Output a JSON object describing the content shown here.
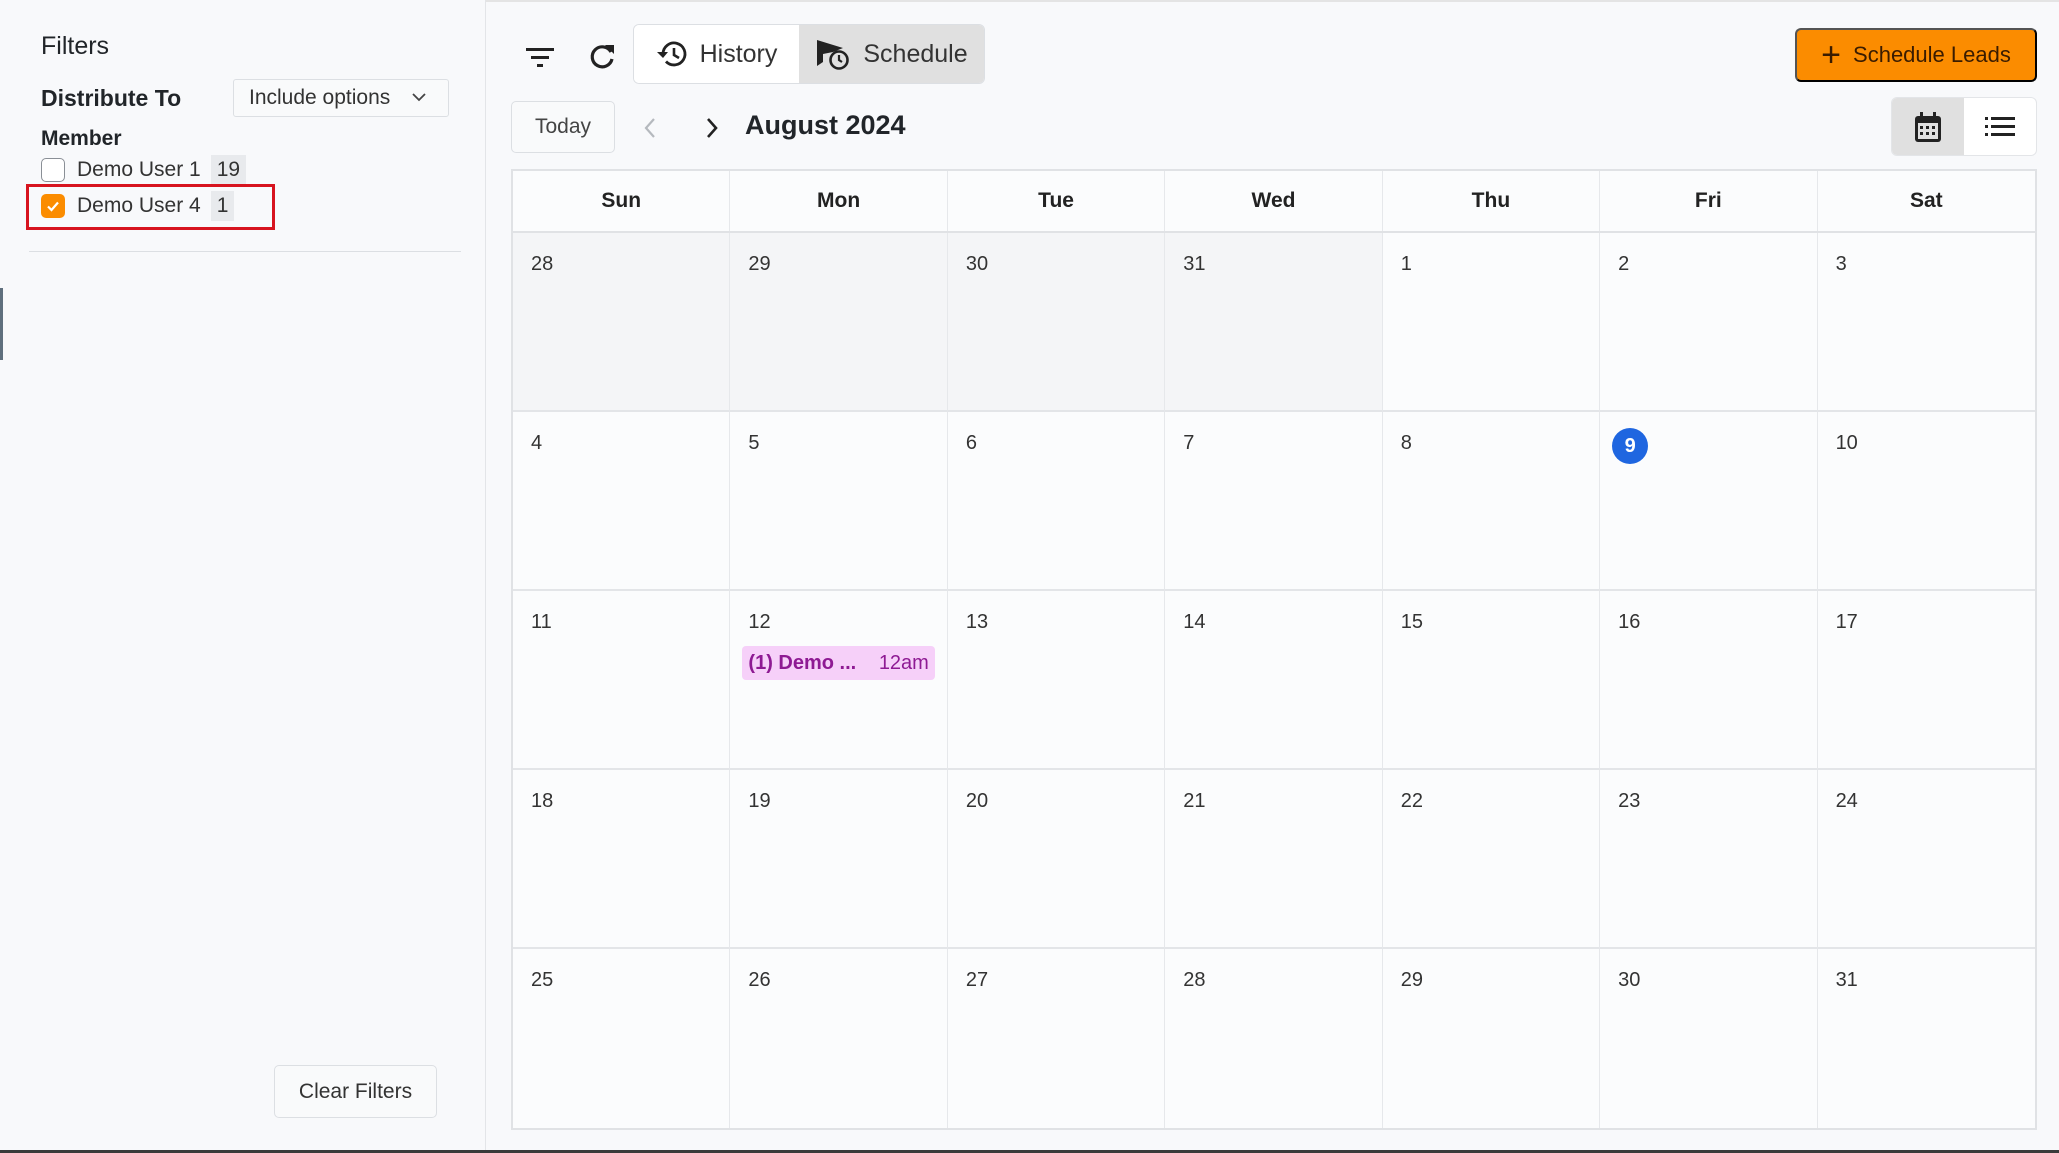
{
  "sidebar": {
    "title": "Filters",
    "distribute_to": {
      "label": "Distribute To",
      "selected": "Include options"
    },
    "member_label": "Member",
    "members": [
      {
        "name": "Demo User 1",
        "count": "19",
        "checked": false
      },
      {
        "name": "Demo User 4",
        "count": "1",
        "checked": true
      }
    ],
    "clear_button": "Clear Filters"
  },
  "toolbar": {
    "filter_icon": "filter-icon",
    "refresh_icon": "refresh-icon",
    "tabs": [
      {
        "label": "History",
        "icon": "history-icon",
        "active": false
      },
      {
        "label": "Schedule",
        "icon": "schedule-icon",
        "active": true
      }
    ],
    "schedule_leads_label": "Schedule Leads",
    "accent_color": "#fb8c00"
  },
  "calendar_nav": {
    "today_label": "Today",
    "month_title": "August 2024",
    "views": [
      {
        "name": "calendar-view",
        "active": true
      },
      {
        "name": "list-view",
        "active": false
      }
    ]
  },
  "calendar": {
    "weekdays": [
      "Sun",
      "Mon",
      "Tue",
      "Wed",
      "Thu",
      "Fri",
      "Sat"
    ],
    "today": "9",
    "today_color": "#1f66e0",
    "weeks": [
      [
        {
          "day": "28",
          "other": true
        },
        {
          "day": "29",
          "other": true
        },
        {
          "day": "30",
          "other": true
        },
        {
          "day": "31",
          "other": true
        },
        {
          "day": "1"
        },
        {
          "day": "2"
        },
        {
          "day": "3"
        }
      ],
      [
        {
          "day": "4"
        },
        {
          "day": "5"
        },
        {
          "day": "6"
        },
        {
          "day": "7"
        },
        {
          "day": "8"
        },
        {
          "day": "9",
          "today": true
        },
        {
          "day": "10"
        }
      ],
      [
        {
          "day": "11"
        },
        {
          "day": "12",
          "events": [
            {
              "title": "(1) Demo ...",
              "time": "12am"
            }
          ]
        },
        {
          "day": "13"
        },
        {
          "day": "14"
        },
        {
          "day": "15"
        },
        {
          "day": "16"
        },
        {
          "day": "17"
        }
      ],
      [
        {
          "day": "18"
        },
        {
          "day": "19"
        },
        {
          "day": "20"
        },
        {
          "day": "21"
        },
        {
          "day": "22"
        },
        {
          "day": "23"
        },
        {
          "day": "24"
        }
      ],
      [
        {
          "day": "25"
        },
        {
          "day": "26"
        },
        {
          "day": "27"
        },
        {
          "day": "28"
        },
        {
          "day": "29"
        },
        {
          "day": "30"
        },
        {
          "day": "31"
        }
      ]
    ]
  }
}
